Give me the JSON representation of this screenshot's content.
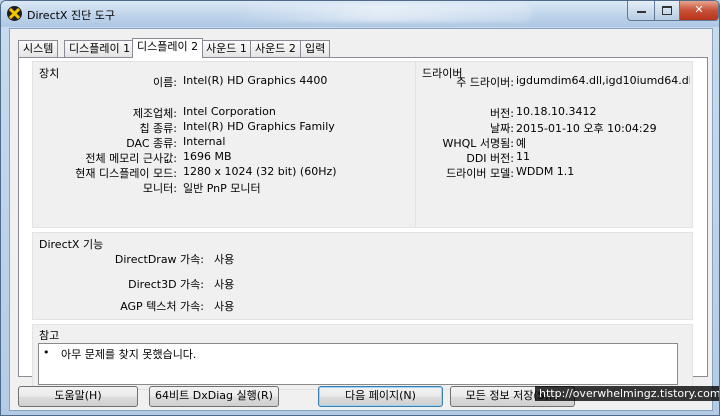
{
  "window": {
    "title": "DirectX 진단 도구"
  },
  "tabs": [
    {
      "label": "시스템"
    },
    {
      "label": "디스플레이 1"
    },
    {
      "label": "디스플레이 2"
    },
    {
      "label": "사운드 1"
    },
    {
      "label": "사운드 2"
    },
    {
      "label": "입력"
    }
  ],
  "active_tab": "디스플레이 2",
  "device": {
    "title": "장치",
    "rows": [
      {
        "label": "이름:",
        "value": "Intel(R) HD Graphics 4400"
      },
      {
        "label": "제조업체:",
        "value": "Intel Corporation"
      },
      {
        "label": "칩 종류:",
        "value": "Intel(R) HD Graphics Family"
      },
      {
        "label": "DAC 종류:",
        "value": "Internal"
      },
      {
        "label": "전체 메모리 근사값:",
        "value": "1696 MB"
      },
      {
        "label": "현재 디스플레이 모드:",
        "value": "1280 x 1024 (32 bit) (60Hz)"
      },
      {
        "label": "모니터:",
        "value": "일반 PnP 모니터"
      }
    ]
  },
  "driver": {
    "title": "드라이버",
    "rows": [
      {
        "label": "주 드라이버:",
        "value": "igdumdim64.dll,igd10iumd64.dll,igd10"
      },
      {
        "label": "버전:",
        "value": "10.18.10.3412"
      },
      {
        "label": "날짜:",
        "value": "2015-01-10 오후 10:04:29"
      },
      {
        "label": "WHQL 서명됨:",
        "value": "예"
      },
      {
        "label": "DDI 버전:",
        "value": "11"
      },
      {
        "label": "드라이버 모델:",
        "value": "WDDM 1.1"
      }
    ]
  },
  "directx": {
    "title": "DirectX 기능",
    "rows": [
      {
        "label": "DirectDraw 가속:",
        "value": "사용"
      },
      {
        "label": "Direct3D 가속:",
        "value": "사용"
      },
      {
        "label": "AGP 텍스처 가속:",
        "value": "사용"
      }
    ]
  },
  "notes": {
    "title": "참고",
    "bullet": "•",
    "text": "아무 문제를 찾지 못했습니다."
  },
  "buttons": {
    "help": "도움말(H)",
    "dxdiag64": "64비트 DxDiag 실행(R)",
    "next_page": "다음 페이지(N)",
    "save_all": "모든 정보 저장(S)..."
  },
  "watermark": "http://overwhelmingz.tistory.com"
}
